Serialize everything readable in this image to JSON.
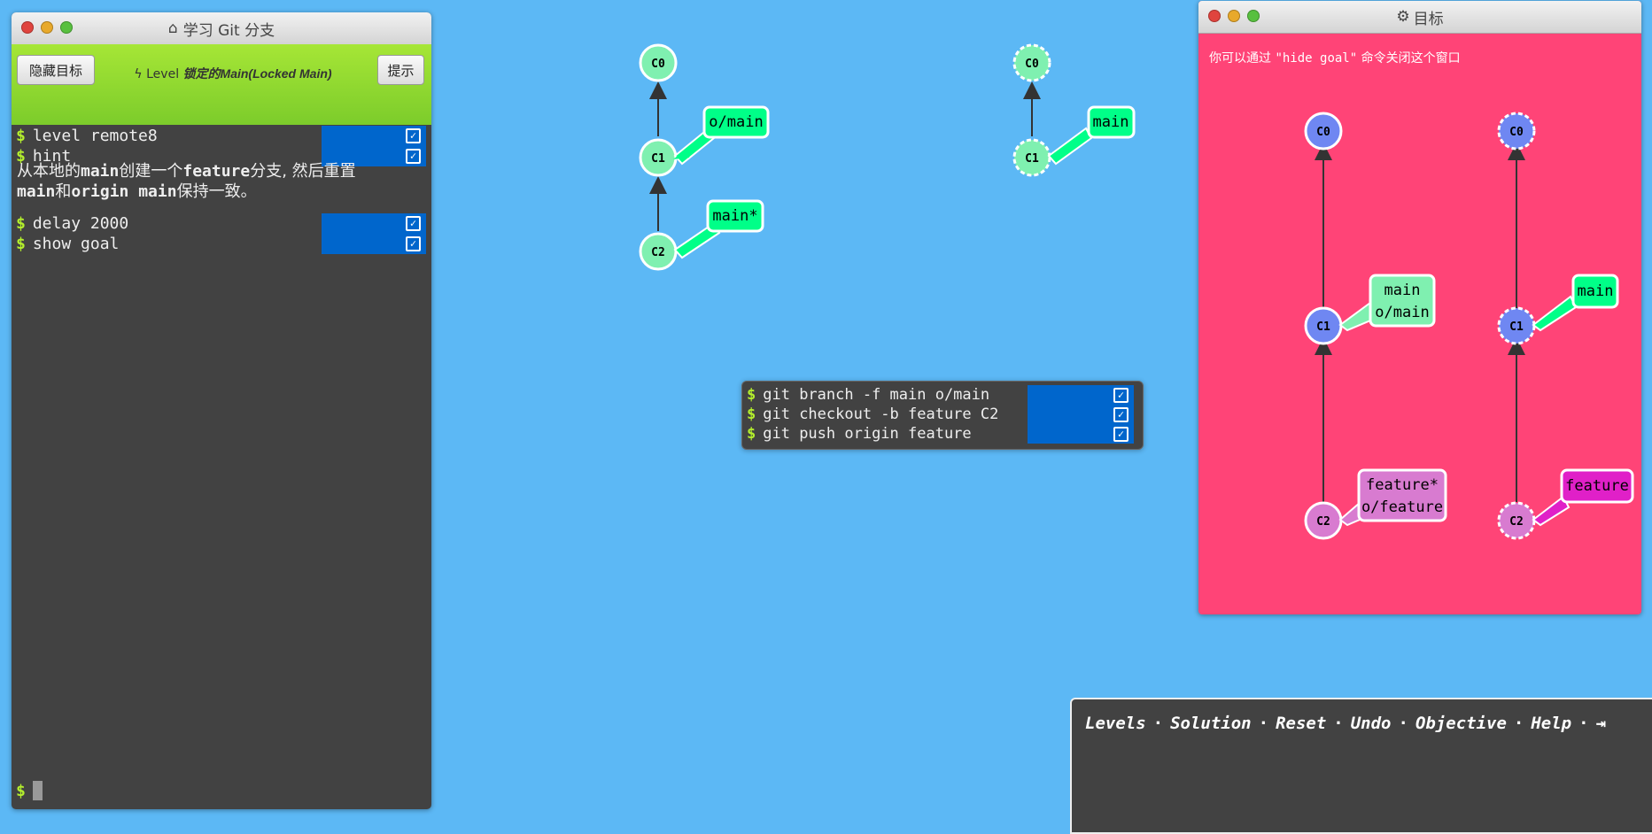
{
  "console": {
    "title": "学习 Git 分支",
    "hide_goal_label": "隐藏目标",
    "level_prefix": "Level",
    "level_name": "锁定的Main(Locked Main)",
    "hint_label": "提示",
    "commands": [
      {
        "text": "level remote8"
      },
      {
        "text": "hint"
      }
    ],
    "hint_parts": [
      "从本地的",
      "main",
      "创建一个",
      "feature",
      "分支, 然后重置",
      "main",
      "和",
      "origin main",
      "保持一致。"
    ],
    "commands2": [
      {
        "text": "delay 2000"
      },
      {
        "text": "show goal"
      }
    ],
    "prompt": "$"
  },
  "history": {
    "commands": [
      {
        "text": "git branch -f main o/main"
      },
      {
        "text": "git checkout -b feature C2"
      },
      {
        "text": "git push origin feature"
      }
    ]
  },
  "main_view": {
    "local": {
      "commits": [
        "C0",
        "C1",
        "C2"
      ],
      "branches": [
        "o/main",
        "main*"
      ]
    },
    "remote": {
      "commits": [
        "C0",
        "C1"
      ],
      "branches": [
        "main"
      ]
    }
  },
  "goal": {
    "title": "目标",
    "note_prefix": "你可以通过 ",
    "note_cmd": "\"hide goal\"",
    "note_suffix": " 命令关闭这个窗口",
    "local": {
      "commits": [
        "C0",
        "C1",
        "C2"
      ],
      "branch_c1": [
        "main",
        "o/main"
      ],
      "branch_c2": [
        "feature*",
        "o/feature"
      ]
    },
    "remote": {
      "commits": [
        "C0",
        "C1",
        "C2"
      ],
      "branch_c1": "main",
      "branch_c2": "feature"
    }
  },
  "nav": {
    "links": [
      "Levels",
      "Solution",
      "Reset",
      "Undo",
      "Objective",
      "Help"
    ],
    "separator": "·"
  },
  "colors": {
    "background": "#5cb8f5",
    "commit_green": "#7ff0b0",
    "branch_green": "#00ff88",
    "goal_bg": "#ff4477",
    "goal_commit_blue": "#6f87f2",
    "goal_commit_purple": "#d87bd0",
    "feature_magenta": "#e020c8",
    "terminal_bg": "#424242",
    "status_blue": "#0066cc",
    "dollar_green": "#b4ef2d"
  }
}
